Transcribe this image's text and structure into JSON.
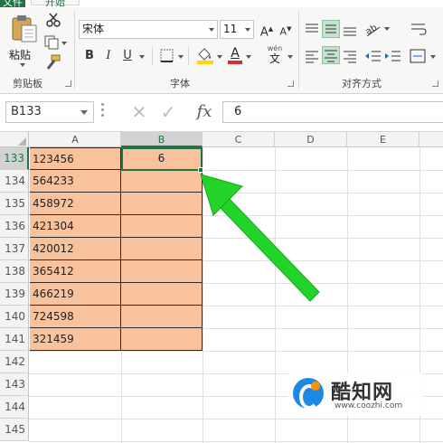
{
  "ribbon": {
    "tabs": {
      "file": "文件",
      "home": "开始"
    },
    "font_name": "宋体",
    "font_size": "11",
    "font_group_label": "字体",
    "clipboard_group_label": "剪贴板",
    "align_group_label": "对齐方式",
    "paste_label": "粘贴",
    "bold": "B",
    "italic": "I",
    "underline": "U",
    "wen": "wén",
    "wen_char": "文",
    "grow": "A",
    "shrink": "A",
    "accent_color": "#217346",
    "font_color": "#d32f2f",
    "highlight_color": "#ffd600"
  },
  "formula_bar": {
    "name_box": "B133",
    "fx": "fx",
    "value": "6",
    "cancel_glyph": "✕",
    "enter_glyph": "✓"
  },
  "sheet": {
    "columns": [
      "A",
      "B",
      "C",
      "D",
      "E"
    ],
    "selected_column": "B",
    "rows": [
      {
        "num": "133",
        "a": "123456",
        "b": "6"
      },
      {
        "num": "134",
        "a": "564233",
        "b": ""
      },
      {
        "num": "135",
        "a": "458972",
        "b": ""
      },
      {
        "num": "136",
        "a": "421304",
        "b": ""
      },
      {
        "num": "137",
        "a": "420012",
        "b": ""
      },
      {
        "num": "138",
        "a": "365412",
        "b": ""
      },
      {
        "num": "139",
        "a": "466219",
        "b": ""
      },
      {
        "num": "140",
        "a": "724598",
        "b": ""
      },
      {
        "num": "141",
        "a": "321459",
        "b": ""
      },
      {
        "num": "142",
        "a": "",
        "b": ""
      },
      {
        "num": "143",
        "a": "",
        "b": ""
      },
      {
        "num": "144",
        "a": "",
        "b": ""
      },
      {
        "num": "145",
        "a": "",
        "b": ""
      }
    ],
    "fill_color": "#f7c29c",
    "selection_color": "#217346"
  },
  "annotation": {
    "arrow_color": "#22d42a"
  },
  "watermark": {
    "name": "酷知网",
    "url": "www.coozhi.com"
  }
}
